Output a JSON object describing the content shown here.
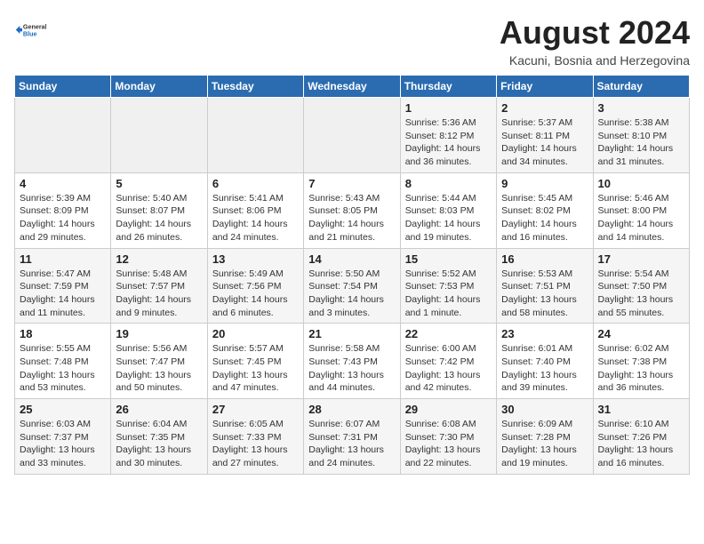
{
  "logo": {
    "general": "General",
    "blue": "Blue"
  },
  "header": {
    "month_year": "August 2024",
    "location": "Kacuni, Bosnia and Herzegovina"
  },
  "weekdays": [
    "Sunday",
    "Monday",
    "Tuesday",
    "Wednesday",
    "Thursday",
    "Friday",
    "Saturday"
  ],
  "weeks": [
    [
      {
        "day": "",
        "info": ""
      },
      {
        "day": "",
        "info": ""
      },
      {
        "day": "",
        "info": ""
      },
      {
        "day": "",
        "info": ""
      },
      {
        "day": "1",
        "info": "Sunrise: 5:36 AM\nSunset: 8:12 PM\nDaylight: 14 hours\nand 36 minutes."
      },
      {
        "day": "2",
        "info": "Sunrise: 5:37 AM\nSunset: 8:11 PM\nDaylight: 14 hours\nand 34 minutes."
      },
      {
        "day": "3",
        "info": "Sunrise: 5:38 AM\nSunset: 8:10 PM\nDaylight: 14 hours\nand 31 minutes."
      }
    ],
    [
      {
        "day": "4",
        "info": "Sunrise: 5:39 AM\nSunset: 8:09 PM\nDaylight: 14 hours\nand 29 minutes."
      },
      {
        "day": "5",
        "info": "Sunrise: 5:40 AM\nSunset: 8:07 PM\nDaylight: 14 hours\nand 26 minutes."
      },
      {
        "day": "6",
        "info": "Sunrise: 5:41 AM\nSunset: 8:06 PM\nDaylight: 14 hours\nand 24 minutes."
      },
      {
        "day": "7",
        "info": "Sunrise: 5:43 AM\nSunset: 8:05 PM\nDaylight: 14 hours\nand 21 minutes."
      },
      {
        "day": "8",
        "info": "Sunrise: 5:44 AM\nSunset: 8:03 PM\nDaylight: 14 hours\nand 19 minutes."
      },
      {
        "day": "9",
        "info": "Sunrise: 5:45 AM\nSunset: 8:02 PM\nDaylight: 14 hours\nand 16 minutes."
      },
      {
        "day": "10",
        "info": "Sunrise: 5:46 AM\nSunset: 8:00 PM\nDaylight: 14 hours\nand 14 minutes."
      }
    ],
    [
      {
        "day": "11",
        "info": "Sunrise: 5:47 AM\nSunset: 7:59 PM\nDaylight: 14 hours\nand 11 minutes."
      },
      {
        "day": "12",
        "info": "Sunrise: 5:48 AM\nSunset: 7:57 PM\nDaylight: 14 hours\nand 9 minutes."
      },
      {
        "day": "13",
        "info": "Sunrise: 5:49 AM\nSunset: 7:56 PM\nDaylight: 14 hours\nand 6 minutes."
      },
      {
        "day": "14",
        "info": "Sunrise: 5:50 AM\nSunset: 7:54 PM\nDaylight: 14 hours\nand 3 minutes."
      },
      {
        "day": "15",
        "info": "Sunrise: 5:52 AM\nSunset: 7:53 PM\nDaylight: 14 hours\nand 1 minute."
      },
      {
        "day": "16",
        "info": "Sunrise: 5:53 AM\nSunset: 7:51 PM\nDaylight: 13 hours\nand 58 minutes."
      },
      {
        "day": "17",
        "info": "Sunrise: 5:54 AM\nSunset: 7:50 PM\nDaylight: 13 hours\nand 55 minutes."
      }
    ],
    [
      {
        "day": "18",
        "info": "Sunrise: 5:55 AM\nSunset: 7:48 PM\nDaylight: 13 hours\nand 53 minutes."
      },
      {
        "day": "19",
        "info": "Sunrise: 5:56 AM\nSunset: 7:47 PM\nDaylight: 13 hours\nand 50 minutes."
      },
      {
        "day": "20",
        "info": "Sunrise: 5:57 AM\nSunset: 7:45 PM\nDaylight: 13 hours\nand 47 minutes."
      },
      {
        "day": "21",
        "info": "Sunrise: 5:58 AM\nSunset: 7:43 PM\nDaylight: 13 hours\nand 44 minutes."
      },
      {
        "day": "22",
        "info": "Sunrise: 6:00 AM\nSunset: 7:42 PM\nDaylight: 13 hours\nand 42 minutes."
      },
      {
        "day": "23",
        "info": "Sunrise: 6:01 AM\nSunset: 7:40 PM\nDaylight: 13 hours\nand 39 minutes."
      },
      {
        "day": "24",
        "info": "Sunrise: 6:02 AM\nSunset: 7:38 PM\nDaylight: 13 hours\nand 36 minutes."
      }
    ],
    [
      {
        "day": "25",
        "info": "Sunrise: 6:03 AM\nSunset: 7:37 PM\nDaylight: 13 hours\nand 33 minutes."
      },
      {
        "day": "26",
        "info": "Sunrise: 6:04 AM\nSunset: 7:35 PM\nDaylight: 13 hours\nand 30 minutes."
      },
      {
        "day": "27",
        "info": "Sunrise: 6:05 AM\nSunset: 7:33 PM\nDaylight: 13 hours\nand 27 minutes."
      },
      {
        "day": "28",
        "info": "Sunrise: 6:07 AM\nSunset: 7:31 PM\nDaylight: 13 hours\nand 24 minutes."
      },
      {
        "day": "29",
        "info": "Sunrise: 6:08 AM\nSunset: 7:30 PM\nDaylight: 13 hours\nand 22 minutes."
      },
      {
        "day": "30",
        "info": "Sunrise: 6:09 AM\nSunset: 7:28 PM\nDaylight: 13 hours\nand 19 minutes."
      },
      {
        "day": "31",
        "info": "Sunrise: 6:10 AM\nSunset: 7:26 PM\nDaylight: 13 hours\nand 16 minutes."
      }
    ]
  ]
}
